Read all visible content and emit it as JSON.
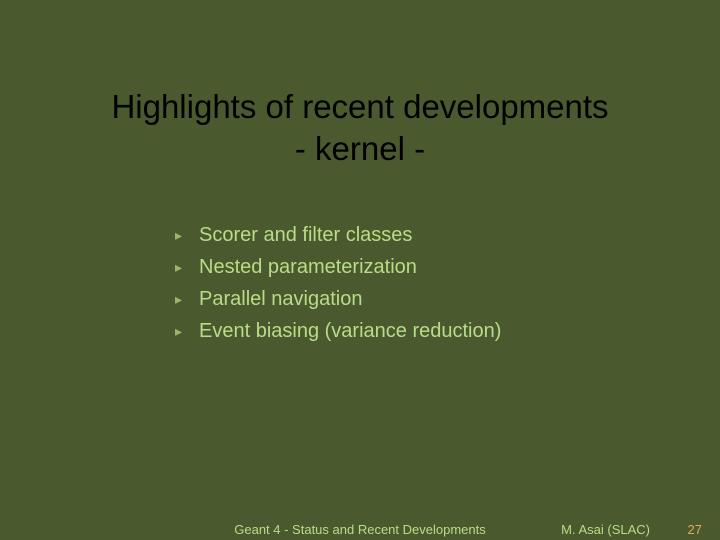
{
  "title_line1": "Highlights of recent developments",
  "title_line2": "- kernel -",
  "bullets": {
    "b0": "Scorer and filter classes",
    "b1": "Nested parameterization",
    "b2": "Parallel navigation",
    "b3": "Event biasing (variance reduction)"
  },
  "footer": {
    "center": "Geant 4 - Status and Recent Developments",
    "right": "M. Asai (SLAC)",
    "page": "27"
  }
}
